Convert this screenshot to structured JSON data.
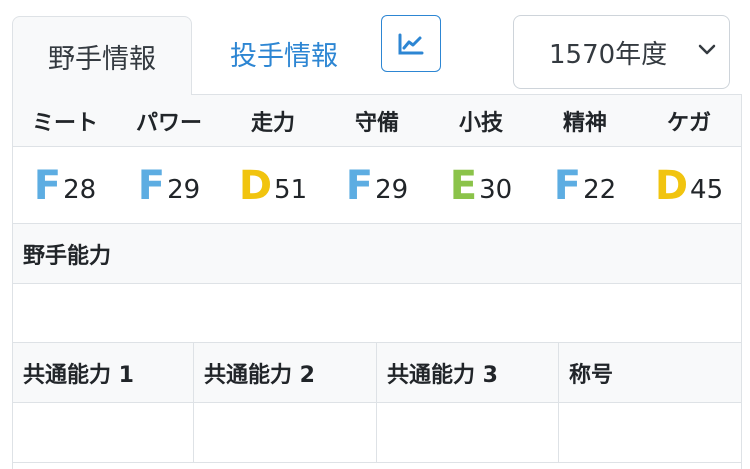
{
  "tabs": {
    "fielder": "野手情報",
    "pitcher": "投手情報"
  },
  "year_select": {
    "selected": "1570年度"
  },
  "stats": {
    "headers": [
      "ミート",
      "パワー",
      "走力",
      "守備",
      "小技",
      "精神",
      "ケガ"
    ],
    "values": [
      {
        "grade": "F",
        "value": "28",
        "color": "#5dade2"
      },
      {
        "grade": "F",
        "value": "29",
        "color": "#5dade2"
      },
      {
        "grade": "D",
        "value": "51",
        "color": "#f1c40f"
      },
      {
        "grade": "F",
        "value": "29",
        "color": "#5dade2"
      },
      {
        "grade": "E",
        "value": "30",
        "color": "#8bc34a"
      },
      {
        "grade": "F",
        "value": "22",
        "color": "#5dade2"
      },
      {
        "grade": "D",
        "value": "45",
        "color": "#f1c40f"
      }
    ]
  },
  "fielder_ability": {
    "title": "野手能力"
  },
  "abilities": {
    "headers": [
      "共通能力 1",
      "共通能力 2",
      "共通能力 3",
      "称号"
    ]
  },
  "colors": {
    "link": "#2d86d3",
    "grade_F": "#5dade2",
    "grade_E": "#8bc34a",
    "grade_D": "#f1c40f"
  },
  "icons": {
    "chart_button": "line-chart-icon",
    "select": "chevron-down-icon"
  }
}
